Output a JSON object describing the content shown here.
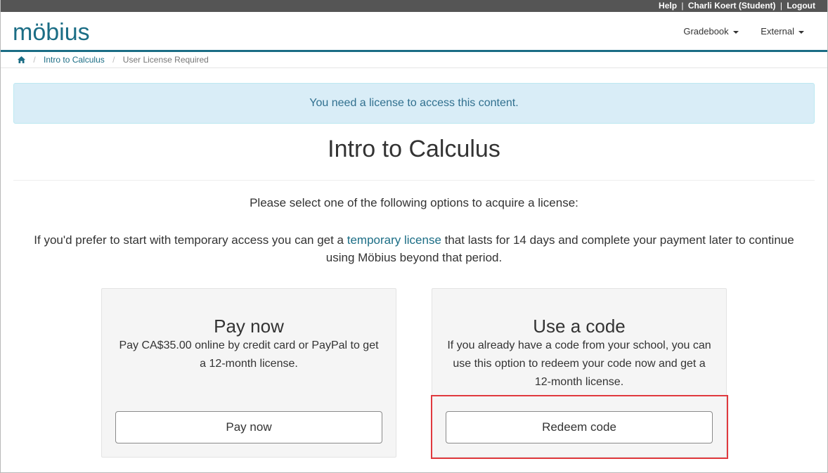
{
  "topbar": {
    "help": "Help",
    "user": "Charli Koert (Student)",
    "logout": "Logout",
    "separator": "|"
  },
  "brand": {
    "name": "möbius",
    "color": "#1b6d85"
  },
  "nav": {
    "gradebook": "Gradebook",
    "external": "External"
  },
  "breadcrumb": {
    "home_icon": "home-icon",
    "course": "Intro to Calculus",
    "current": "User License Required",
    "divider": "/"
  },
  "alert": {
    "message": "You need a license to access this content."
  },
  "page": {
    "title": "Intro to Calculus",
    "select_message": "Please select one of the following options to acquire a license:",
    "temp_before": "If you'd prefer to start with temporary access you can get a ",
    "temp_link": "temporary license",
    "temp_after": " that lasts for 14 days and complete your payment later to continue using Möbius beyond that period."
  },
  "options": {
    "pay": {
      "title": "Pay now",
      "description": "Pay CA$35.00 online by credit card or PayPal to get a 12-month license.",
      "button": "Pay now"
    },
    "code": {
      "title": "Use a code",
      "description": "If you already have a code from your school, you can use this option to redeem your code now and get a 12-month license.",
      "button": "Redeem code"
    }
  },
  "colors": {
    "alert_bg": "#d9edf7",
    "alert_text": "#31708f",
    "highlight": "#e0393e",
    "topbar_bg": "#555555"
  }
}
